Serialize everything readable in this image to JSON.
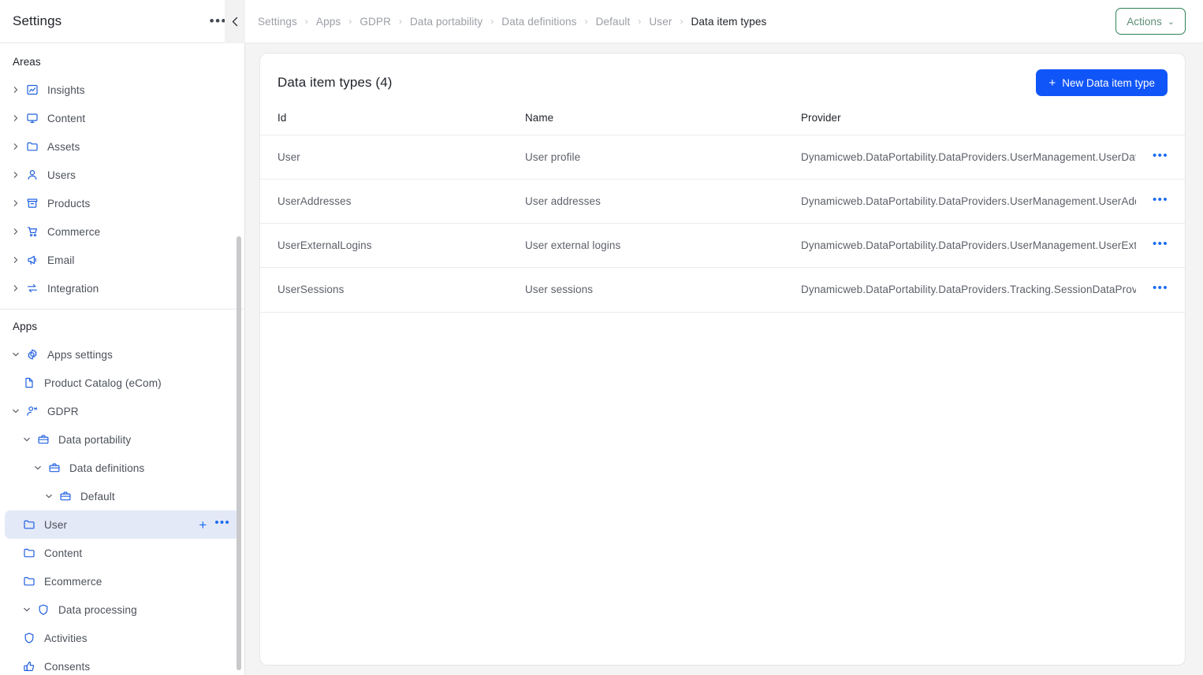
{
  "sidebar": {
    "title": "Settings",
    "header_menu_icon": "ellipsis-icon",
    "collapse_icon": "chevron-left-icon",
    "sections": [
      {
        "label": "Areas",
        "items": [
          {
            "label": "Insights",
            "icon": "chart-line-icon",
            "level": 0,
            "caret": "collapsed"
          },
          {
            "label": "Content",
            "icon": "monitor-icon",
            "level": 0,
            "caret": "collapsed"
          },
          {
            "label": "Assets",
            "icon": "folder-icon",
            "level": 0,
            "caret": "collapsed"
          },
          {
            "label": "Users",
            "icon": "user-icon",
            "level": 0,
            "caret": "collapsed"
          },
          {
            "label": "Products",
            "icon": "box-icon",
            "level": 0,
            "caret": "collapsed"
          },
          {
            "label": "Commerce",
            "icon": "cart-icon",
            "level": 0,
            "caret": "collapsed"
          },
          {
            "label": "Email",
            "icon": "megaphone-icon",
            "level": 0,
            "caret": "collapsed"
          },
          {
            "label": "Integration",
            "icon": "exchange-icon",
            "level": 0,
            "caret": "collapsed"
          }
        ]
      },
      {
        "label": "Apps",
        "items": [
          {
            "label": "Apps settings",
            "icon": "gear-icon",
            "level": 0,
            "caret": "expanded"
          },
          {
            "label": "Product Catalog (eCom)",
            "icon": "file-icon",
            "level": 1,
            "caret": "none"
          },
          {
            "label": "GDPR",
            "icon": "user-key-icon",
            "level": 0,
            "caret": "expanded"
          },
          {
            "label": "Data portability",
            "icon": "briefcase-icon",
            "level": 1,
            "caret": "expanded"
          },
          {
            "label": "Data definitions",
            "icon": "briefcase-icon",
            "level": 2,
            "caret": "expanded"
          },
          {
            "label": "Default",
            "icon": "briefcase-icon",
            "level": 3,
            "caret": "expanded"
          },
          {
            "label": "User",
            "icon": "folder-icon",
            "level": 4,
            "caret": "none",
            "selected": true,
            "row_actions": {
              "add": "+",
              "menu": "•••"
            }
          },
          {
            "label": "Content",
            "icon": "folder-icon",
            "level": 4,
            "caret": "none"
          },
          {
            "label": "Ecommerce",
            "icon": "folder-icon",
            "level": 4,
            "caret": "none"
          },
          {
            "label": "Data processing",
            "icon": "shield-icon",
            "level": 1,
            "caret": "expanded"
          },
          {
            "label": "Activities",
            "icon": "shield-icon",
            "level": 2,
            "caret": "none"
          },
          {
            "label": "Consents",
            "icon": "thumbs-up-icon",
            "level": 2,
            "caret": "none"
          }
        ]
      }
    ]
  },
  "topbar": {
    "breadcrumbs": [
      "Settings",
      "Apps",
      "GDPR",
      "Data portability",
      "Data definitions",
      "Default",
      "User",
      "Data item types"
    ],
    "separator": "›",
    "actions_button": {
      "label": "Actions",
      "chevron": "⌄"
    }
  },
  "card": {
    "title": "Data item types (4)",
    "new_button": {
      "plus": "+",
      "label": "New Data item type"
    },
    "columns": [
      "Id",
      "Name",
      "Provider",
      ""
    ],
    "rows": [
      {
        "id": "User",
        "name": "User profile",
        "provider": "Dynamicweb.DataPortability.DataProviders.UserManagement.UserDataProvider",
        "menu": "•••"
      },
      {
        "id": "UserAddresses",
        "name": "User addresses",
        "provider": "Dynamicweb.DataPortability.DataProviders.UserManagement.UserAddressDataProvider",
        "menu": "•••"
      },
      {
        "id": "UserExternalLogins",
        "name": "User external logins",
        "provider": "Dynamicweb.DataPortability.DataProviders.UserManagement.UserExternalLoginDataProvider",
        "menu": "•••"
      },
      {
        "id": "UserSessions",
        "name": "User sessions",
        "provider": "Dynamicweb.DataPortability.DataProviders.Tracking.SessionDataProvider",
        "menu": "•••"
      }
    ]
  },
  "colors": {
    "accent_blue": "#1055f8",
    "icon_blue": "#1f5fe0",
    "selected_bg": "#e3e9f7",
    "actions_green": "#2f8157",
    "text_primary": "#21242b",
    "text_muted": "#9b9ea5",
    "page_bg": "#f4f4f5"
  }
}
